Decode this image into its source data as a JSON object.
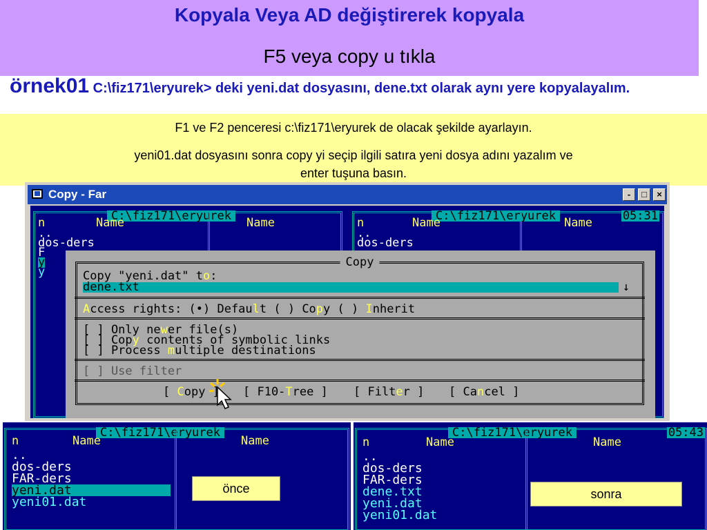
{
  "banner": {
    "title": "Kopyala Veya AD değiştirerek kopyala",
    "subtitle": "F5 veya copy u tıkla"
  },
  "example": {
    "label": "örnek01",
    "text": "C:\\fiz171\\eryurek> deki yeni.dat dosyasını, dene.txt olarak aynı yere kopyalayalım."
  },
  "note": {
    "line1": "F1 ve F2 penceresi c:\\fiz171\\eryurek de olacak şekilde ayarlayın.",
    "line2": "yeni01.dat dosyasını sonra copy yi seçip  ilgili satıra yeni dosya adını yazalım ve",
    "line3": "enter tuşuna basın."
  },
  "window": {
    "title": "Copy - Far",
    "buttons": [
      "-",
      "□",
      "×"
    ]
  },
  "far_top": {
    "left_path": "C:\\fiz171\\eryurek",
    "right_path": "C:\\fiz171\\eryurek",
    "clock": "05:31",
    "col_n": "n",
    "col_name": "Name",
    "left_items": [
      "..",
      "dos-ders",
      "F",
      "y",
      "y"
    ],
    "right_items": [
      "..",
      "dos-ders"
    ]
  },
  "dialog": {
    "title": "Copy",
    "copy_prompt_a": "Copy \"yeni.dat\" t",
    "copy_prompt_hk": "o",
    "copy_prompt_b": ":",
    "input_value": "dene.txt",
    "input_arrow": "↓",
    "access_hk": "A",
    "access_a": "ccess rights: (•) Defau",
    "access_hk2": "l",
    "access_b": "t ( ) Co",
    "access_hk3": "p",
    "access_c": "y ( ) ",
    "access_hk4": "I",
    "access_d": "nherit",
    "opt1_a": "[ ] Only ne",
    "opt1_hk": "w",
    "opt1_b": "er file(s)",
    "opt2_a": "[ ] Cop",
    "opt2_hk": "y",
    "opt2_b": " contents of symbolic links",
    "opt3_a": "[ ] Process ",
    "opt3_hk": "m",
    "opt3_b": "ultiple destinations",
    "filter": "[ ] Use filter",
    "btn_copy_a": "[ ",
    "btn_copy_hk": "C",
    "btn_copy_b": "opy ]",
    "btn_tree_a": "[ F10-",
    "btn_tree_hk": "T",
    "btn_tree_b": "ree ]",
    "btn_filter_a": "[ Filt",
    "btn_filter_hk": "e",
    "btn_filter_b": "r ]",
    "btn_cancel_a": "[ Ca",
    "btn_cancel_hk": "n",
    "btn_cancel_b": "cel ]"
  },
  "before": {
    "path": "C:\\fiz171\\eryurek",
    "col_n": "n",
    "col_name": "Name",
    "col_name2": "Name",
    "items": [
      "..",
      "dos-ders",
      "FAR-ders",
      "yeni.dat",
      "yeni01.dat"
    ],
    "tag": "önce"
  },
  "after": {
    "path": "C:\\fiz171\\eryurek",
    "clock": "05:43",
    "col_n": "n",
    "col_name": "Name",
    "col_name2": "Name",
    "items": [
      "..",
      "dos-ders",
      "FAR-ders",
      "dene.txt",
      "yeni.dat",
      "yeni01.dat"
    ],
    "tag": "sonra"
  },
  "colors": {
    "banner_bg": "#cc99ff",
    "note_bg": "#ffff99",
    "far_blue": "#000080",
    "far_cyan": "#00aaaa",
    "dialog_grey": "#aaaaaa"
  }
}
